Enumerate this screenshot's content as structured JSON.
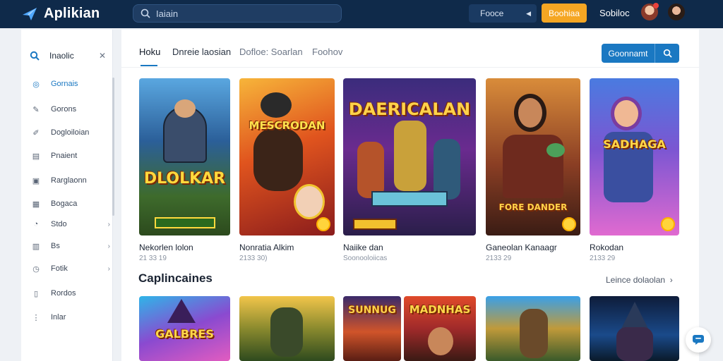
{
  "header": {
    "logo_text": "Aplikian",
    "search_text": "Iaiain",
    "select_label": "Fooce",
    "cta_label": "Boohiaa",
    "user_name": "Sobiloc"
  },
  "sidebar": {
    "head_label": "Inaolic",
    "items": [
      {
        "label": "Gornais",
        "icon": "globe-icon",
        "active": true
      },
      {
        "label": "Gorons",
        "icon": "wrench-icon"
      },
      {
        "label": "Dogloiloian",
        "icon": "pen-icon"
      },
      {
        "label": "Pnaient",
        "icon": "document-icon"
      },
      {
        "label": "Rarglaonn",
        "icon": "image-icon"
      },
      {
        "label": "Bogaca",
        "icon": "book-icon"
      },
      {
        "label": "Stdo",
        "icon": "circle-icon",
        "chevron": true
      },
      {
        "label": "Bs",
        "icon": "grid-icon",
        "chevron": true
      },
      {
        "label": "Fotik",
        "icon": "clock-icon",
        "chevron": true
      },
      {
        "label": "Rordos",
        "icon": "file-icon"
      },
      {
        "label": "Inlar",
        "icon": "dots-icon"
      }
    ]
  },
  "tabs": [
    "Hoku",
    "Dnreie laosian",
    "Dofloe: Soarlan",
    "Foohov"
  ],
  "main_button_label": "Goonnamt",
  "featured": [
    {
      "title": "Nekorlen lolon",
      "sub": "21 33 19",
      "art_text": "DLOLKAR"
    },
    {
      "title": "Nonratia Alkim",
      "sub": "2133 30)",
      "art_text": "MESCRODAN"
    },
    {
      "title": "Naiike dan",
      "sub": "Soonooloiicas",
      "art_text": "DAERICALAN"
    },
    {
      "title": "Ganeolan Kanaagr",
      "sub": "2133 29",
      "art_text": "FORE DANDER"
    },
    {
      "title": "Rokodan",
      "sub": "2133 29",
      "art_text": "SADHAGA"
    }
  ],
  "section_title": "Caplincaines",
  "section_link": "Leince dolaolan",
  "second_row": [
    {
      "art_text": "GALBRES"
    },
    {
      "art_text": ""
    },
    {
      "art_text": "SUNNUG"
    },
    {
      "art_text": "MADNHAS"
    },
    {
      "art_text": ""
    },
    {
      "art_text": ""
    }
  ],
  "colors": {
    "header_bg": "#0f2a4a",
    "accent": "#1a78c2",
    "cta": "#f5a623"
  }
}
